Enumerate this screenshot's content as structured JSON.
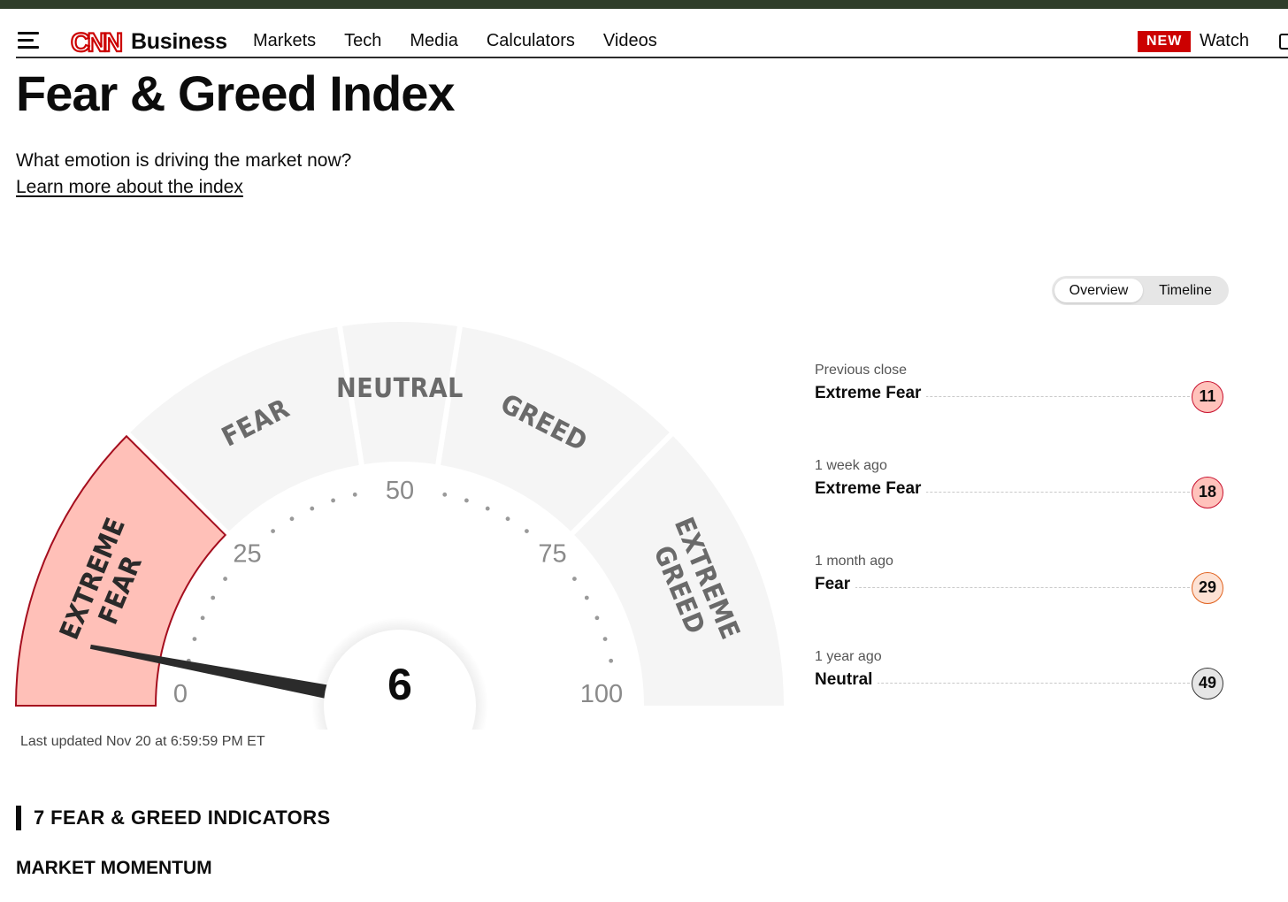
{
  "header": {
    "logo_mark": "CNN",
    "logo_text": "Business",
    "nav": [
      "Markets",
      "Tech",
      "Media",
      "Calculators",
      "Videos"
    ],
    "new_badge": "NEW",
    "watch_label": "Watch"
  },
  "page": {
    "title": "Fear & Greed Index",
    "subtitle": "What emotion is driving the market now?",
    "learn_link": "Learn more about the index"
  },
  "view_toggle": {
    "options": [
      "Overview",
      "Timeline"
    ],
    "selected": "Overview"
  },
  "gauge": {
    "value": 6,
    "current_zone": "EXTREME FEAR",
    "zones": [
      {
        "lines": [
          "EXTREME",
          "FEAR"
        ],
        "from": 0,
        "to": 25
      },
      {
        "lines": [
          "FEAR"
        ],
        "from": 25,
        "to": 45
      },
      {
        "lines": [
          "NEUTRAL"
        ],
        "from": 45,
        "to": 55
      },
      {
        "lines": [
          "GREED"
        ],
        "from": 55,
        "to": 75
      },
      {
        "lines": [
          "EXTREME",
          "GREED"
        ],
        "from": 75,
        "to": 100
      }
    ],
    "tick_labels": [
      0,
      25,
      50,
      75,
      100
    ],
    "colors": {
      "active": "#ffc0b8",
      "active_border": "#a50e1e",
      "zone": "#f5f5f5",
      "needle": "#2b2b2b",
      "zone_text": "#6a6a6a"
    }
  },
  "history": [
    {
      "label": "Previous close",
      "status": "Extreme Fear",
      "value": "11",
      "bg": "#ffc2bb",
      "border": "#c8102e"
    },
    {
      "label": "1 week ago",
      "status": "Extreme Fear",
      "value": "18",
      "bg": "#ffc2bb",
      "border": "#c8102e"
    },
    {
      "label": "1 month ago",
      "status": "Fear",
      "value": "29",
      "bg": "#fde2d4",
      "border": "#e0621f"
    },
    {
      "label": "1 year ago",
      "status": "Neutral",
      "value": "49",
      "bg": "#e6e6e6",
      "border": "#3a3a3a"
    }
  ],
  "last_updated": "Last updated Nov 20 at 6:59:59 PM ET",
  "indicators": {
    "heading": "7 FEAR & GREED INDICATORS",
    "first_section": "MARKET MOMENTUM"
  }
}
